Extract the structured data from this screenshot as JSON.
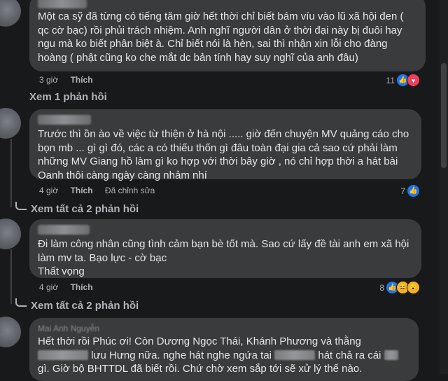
{
  "comments": [
    {
      "text": "Một ca sỹ đã từng có tiếng tăm giờ hết thời chỉ biết bám víu vào lũ xã hội đen ( qc cờ bạc) rồi phủi trách nhiệm. Anh nghĩ người dân ở thời đại này bị đuôi hay ngu mà ko biết phân biệt à. Chỉ biết nói là hèn, sai thì nhận xin lỗi cho đàng hoàng ( phật cũng ko che mắt dc bản tính hay suy nghĩ của anh đâu)",
      "time": "3 giờ",
      "like": "Thích",
      "reactions": "11",
      "reply_link": "Xem 1 phản hồi"
    },
    {
      "text": "Trước thì ồn ào về việc từ thiện ở hà nội ..... giờ đến chuyện MV quảng cáo cho bọn mb ... gì gì đó, các a có thiếu thốn gì đâu toàn đại gia cả sao cứ phải làm những MV Giang hồ làm gì ko hợp với thời bây giờ , nó chỉ hợp thời a hát bài Oanh thôi càng ngày càng nhảm nhí",
      "time": "4 giờ",
      "like": "Thích",
      "edited": "Đã chỉnh sửa",
      "reactions": "7",
      "reply_link": "Xem tất cả 2 phản hồi"
    },
    {
      "text": "Đi làm công nhân cũng tình cảm bạn bè tốt mà. Sao cứ lấy đề tài anh em xã hội làm mv ta. Bạo lực - cờ bạc\nThất vọng",
      "time": "4 giờ",
      "like": "Thích",
      "reactions": "8",
      "reply_link": "Xem tất cả 2 phản hồi"
    },
    {
      "author": "Mai Anh Nguyễn",
      "text_a": "Hết thời rồi Phúc ơi! Còn Dương Ngọc Thái, Khánh Phương và thằng",
      "text_b": "lưu Hưng nữa. nghe hát nghe ngứa tai",
      "text_c": "hát chả ra cái",
      "text_d": "gì. Giờ bộ BHTTDL đã biết rồi. Chứ chờ xem sắp tới sẽ xử lý thế nào."
    }
  ],
  "icons": {
    "like": "👍",
    "love": "♥",
    "haha": "😆",
    "wow": "😮"
  },
  "colors": {
    "background": "#18191a",
    "bubble": "#3a3b3c",
    "like_blue": "#1877f2",
    "love_red": "#f33e58",
    "text": "#e4e6eb",
    "muted": "#b0b3b8"
  }
}
